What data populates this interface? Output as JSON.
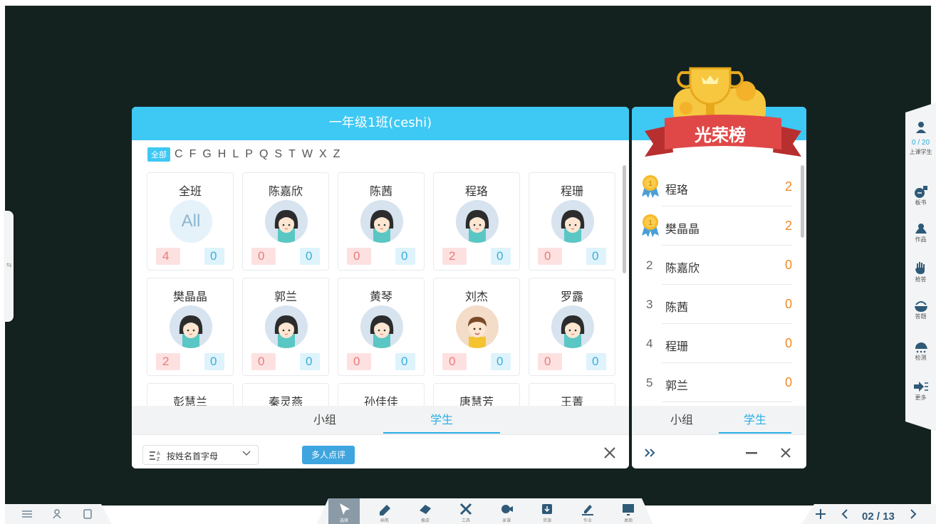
{
  "class_panel": {
    "title": "一年级1班(ceshi)",
    "letter_all": "全部",
    "letters": [
      "C",
      "F",
      "G",
      "H",
      "L",
      "P",
      "Q",
      "S",
      "T",
      "W",
      "X",
      "Z"
    ],
    "students": [
      {
        "name": "全班",
        "type": "all",
        "avatar_text": "All",
        "red": "4",
        "blue": "0"
      },
      {
        "name": "陈嘉欣",
        "type": "girl",
        "red": "0",
        "blue": "0"
      },
      {
        "name": "陈茜",
        "type": "girl",
        "red": "0",
        "blue": "0"
      },
      {
        "name": "程珞",
        "type": "girl",
        "red": "2",
        "blue": "0"
      },
      {
        "name": "程珊",
        "type": "girl",
        "red": "0",
        "blue": "0"
      },
      {
        "name": "樊晶晶",
        "type": "girl",
        "red": "2",
        "blue": "0"
      },
      {
        "name": "郭兰",
        "type": "girl",
        "red": "0",
        "blue": "0"
      },
      {
        "name": "黄琴",
        "type": "girl",
        "red": "0",
        "blue": "0"
      },
      {
        "name": "刘杰",
        "type": "boy",
        "red": "0",
        "blue": "0"
      },
      {
        "name": "罗露",
        "type": "girl",
        "red": "0",
        "blue": "0"
      },
      {
        "name": "彭慧兰",
        "type": "girl"
      },
      {
        "name": "秦灵燕",
        "type": "girl"
      },
      {
        "name": "孙佳佳",
        "type": "girl"
      },
      {
        "name": "唐慧芳",
        "type": "girl"
      },
      {
        "name": "王菁",
        "type": "girl"
      }
    ],
    "tabs": {
      "group": "小组",
      "student": "学生"
    },
    "sort_label": "按姓名首字母",
    "multi_review": "多人点评"
  },
  "honor_panel": {
    "title": "光荣榜",
    "ranking": [
      {
        "rank": "",
        "medal": true,
        "name": "程珞",
        "score": "2"
      },
      {
        "rank": "",
        "medal": true,
        "name": "樊晶晶",
        "score": "2"
      },
      {
        "rank": "2",
        "medal": false,
        "name": "陈嘉欣",
        "score": "0"
      },
      {
        "rank": "3",
        "medal": false,
        "name": "陈茜",
        "score": "0"
      },
      {
        "rank": "4",
        "medal": false,
        "name": "程珊",
        "score": "0"
      },
      {
        "rank": "5",
        "medal": false,
        "name": "郭兰",
        "score": "0"
      }
    ],
    "tabs": {
      "group": "小组",
      "student": "学生"
    }
  },
  "right_dock": {
    "count": "0 / 20",
    "count_label": "上课学生",
    "items": [
      "板书",
      "作品",
      "抢答",
      "答题",
      "检测",
      "更多"
    ]
  },
  "bottom_toolbar": {
    "tools": [
      "选择",
      "画笔",
      "橡皮",
      "工具",
      "录课",
      "资源",
      "作业",
      "桌面"
    ],
    "page": "02 / 13"
  },
  "colors": {
    "accent": "#3ec8f4",
    "board": "#14221f",
    "score_orange": "#f08a24"
  }
}
